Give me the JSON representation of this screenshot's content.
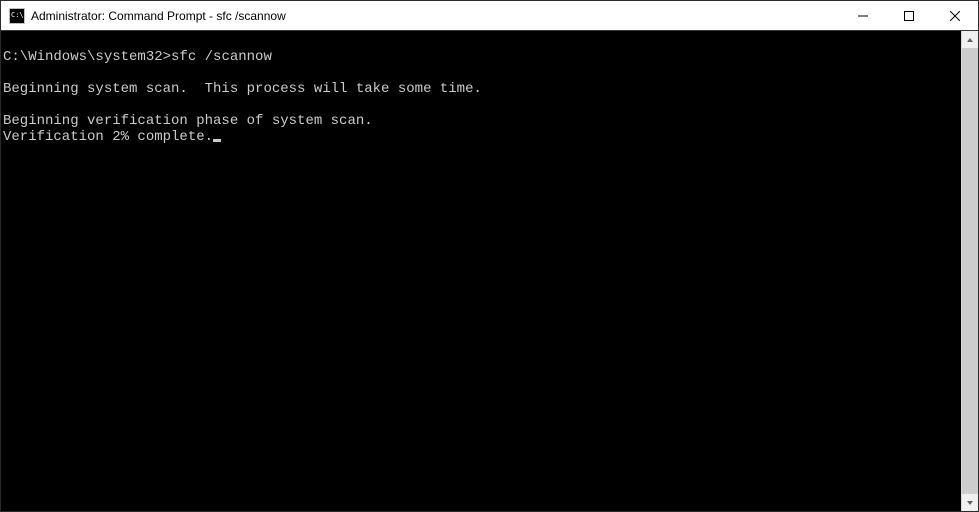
{
  "window": {
    "title": "Administrator: Command Prompt - sfc  /scannow"
  },
  "terminal": {
    "prompt": "C:\\Windows\\system32>",
    "command": "sfc /scannow",
    "lines": {
      "l1": "Beginning system scan.  This process will take some time.",
      "l2": "Beginning verification phase of system scan.",
      "l3": "Verification 2% complete."
    }
  }
}
